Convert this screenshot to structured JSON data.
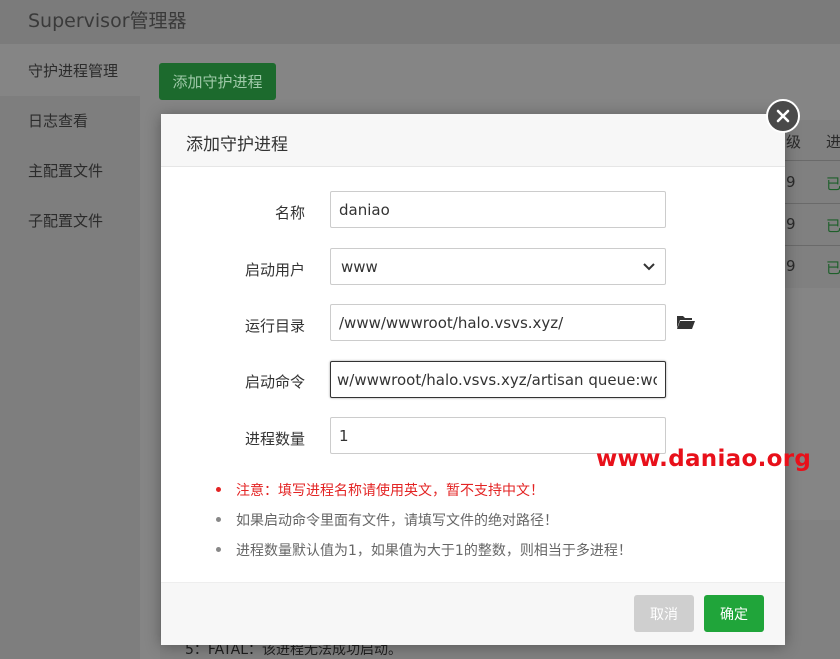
{
  "app": {
    "title": "Supervisor管理器"
  },
  "sidebar": {
    "items": [
      {
        "label": "守护进程管理"
      },
      {
        "label": "日志查看"
      },
      {
        "label": "主配置文件"
      },
      {
        "label": "子配置文件"
      }
    ]
  },
  "toolbar": {
    "add_label": "添加守护进程"
  },
  "table": {
    "headers": [
      "级",
      "进"
    ],
    "rows": [
      {
        "c1": "9",
        "c2": "已"
      },
      {
        "c1": "9",
        "c2": "已"
      },
      {
        "c1": "9",
        "c2": "已"
      }
    ]
  },
  "bottom": {
    "fatal_text": "5：FATAL：该进程无法成功启动。"
  },
  "modal": {
    "title": "添加守护进程",
    "fields": {
      "name": {
        "label": "名称",
        "value": "daniao"
      },
      "user": {
        "label": "启动用户",
        "value": "www"
      },
      "dir": {
        "label": "运行目录",
        "value": "/www/wwwroot/halo.vsvs.xyz/"
      },
      "cmd": {
        "label": "启动命令",
        "value": "w/wwwroot/halo.vsvs.xyz/artisan queue:work"
      },
      "count": {
        "label": "进程数量",
        "value": "1"
      }
    },
    "notes": [
      {
        "text": "注意：填写进程名称请使用英文，暂不支持中文！",
        "color": "#e32424"
      },
      {
        "text": "如果启动命令里面有文件，请填写文件的绝对路径！",
        "color": "#666666"
      },
      {
        "text": "进程数量默认值为1，如果值为大于1的整数，则相当于多进程！",
        "color": "#666666"
      }
    ],
    "cancel_label": "取消",
    "ok_label": "确定"
  },
  "watermark": {
    "text": "www.daniao.org"
  },
  "colors": {
    "accent": "#20a53a",
    "warning": "#e32424",
    "watermark": "#e8101a"
  }
}
